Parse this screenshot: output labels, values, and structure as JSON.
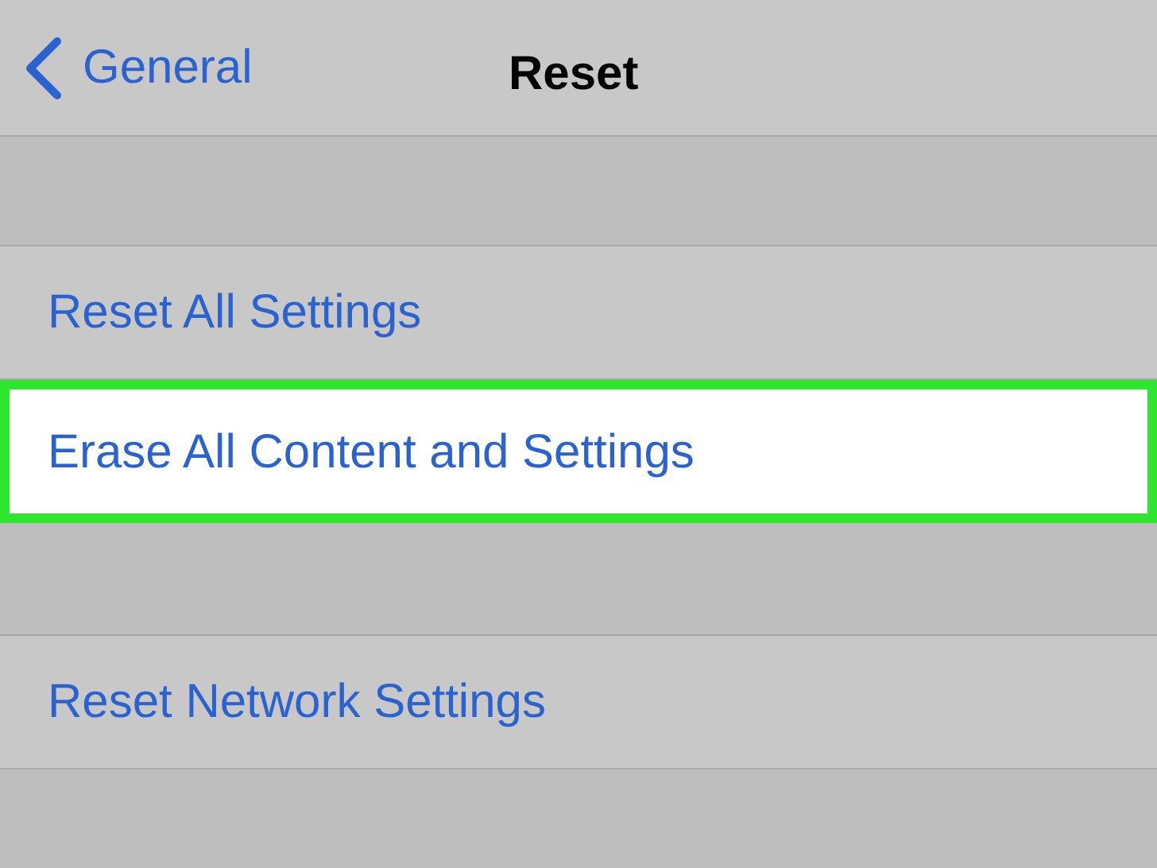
{
  "nav": {
    "back": "General",
    "title": "Reset"
  },
  "sections": [
    {
      "rows": [
        {
          "label": "Reset All Settings",
          "highlighted": false
        },
        {
          "label": "Erase All Content and Settings",
          "highlighted": true
        }
      ]
    },
    {
      "rows": [
        {
          "label": "Reset Network Settings",
          "highlighted": false
        }
      ]
    }
  ]
}
